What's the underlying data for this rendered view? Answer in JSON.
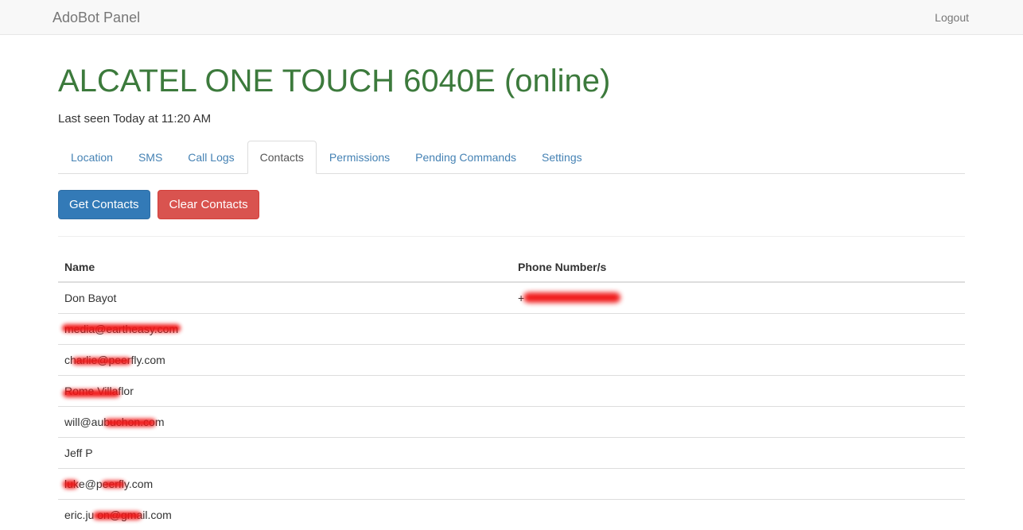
{
  "navbar": {
    "brand": "AdoBot Panel",
    "logout_label": "Logout"
  },
  "header": {
    "title": "ALCATEL ONE TOUCH 6040E (online)",
    "subtitle": "Last seen Today at 11:20 AM",
    "title_color": "#3c7a3c"
  },
  "tabs": [
    {
      "label": "Location",
      "active": false
    },
    {
      "label": "SMS",
      "active": false
    },
    {
      "label": "Call Logs",
      "active": false
    },
    {
      "label": "Contacts",
      "active": true
    },
    {
      "label": "Permissions",
      "active": false
    },
    {
      "label": "Pending Commands",
      "active": false
    },
    {
      "label": "Settings",
      "active": false
    }
  ],
  "toolbar": {
    "get_contacts_label": "Get Contacts",
    "clear_contacts_label": "Clear Contacts",
    "primary_color": "#337ab7",
    "danger_color": "#d9534f"
  },
  "table": {
    "columns": [
      "Name",
      "Phone Number/s"
    ],
    "rows": [
      {
        "name": "Don Bayot",
        "phone": "+",
        "name_redacted": false,
        "phone_redacted": true
      },
      {
        "name": "media@eartheasy.com",
        "phone": "",
        "name_redacted": true,
        "phone_redacted": false
      },
      {
        "name": "charlie@peerfly.com",
        "phone": "",
        "name_redacted": true,
        "phone_redacted": false
      },
      {
        "name": "Rome Villaflor",
        "phone": "",
        "name_redacted": true,
        "phone_redacted": false
      },
      {
        "name": "will@aubuchon.com",
        "phone": "",
        "name_redacted": true,
        "phone_redacted": false
      },
      {
        "name": "Jeff P",
        "phone": "",
        "name_redacted": false,
        "phone_redacted": false
      },
      {
        "name": "luke@peerfly.com",
        "phone": "",
        "name_redacted": true,
        "phone_redacted": false
      },
      {
        "name": "eric.ju          on@gmail.com",
        "phone": "",
        "name_redacted": true,
        "phone_redacted": false
      }
    ]
  },
  "redaction_color": "#f01414"
}
